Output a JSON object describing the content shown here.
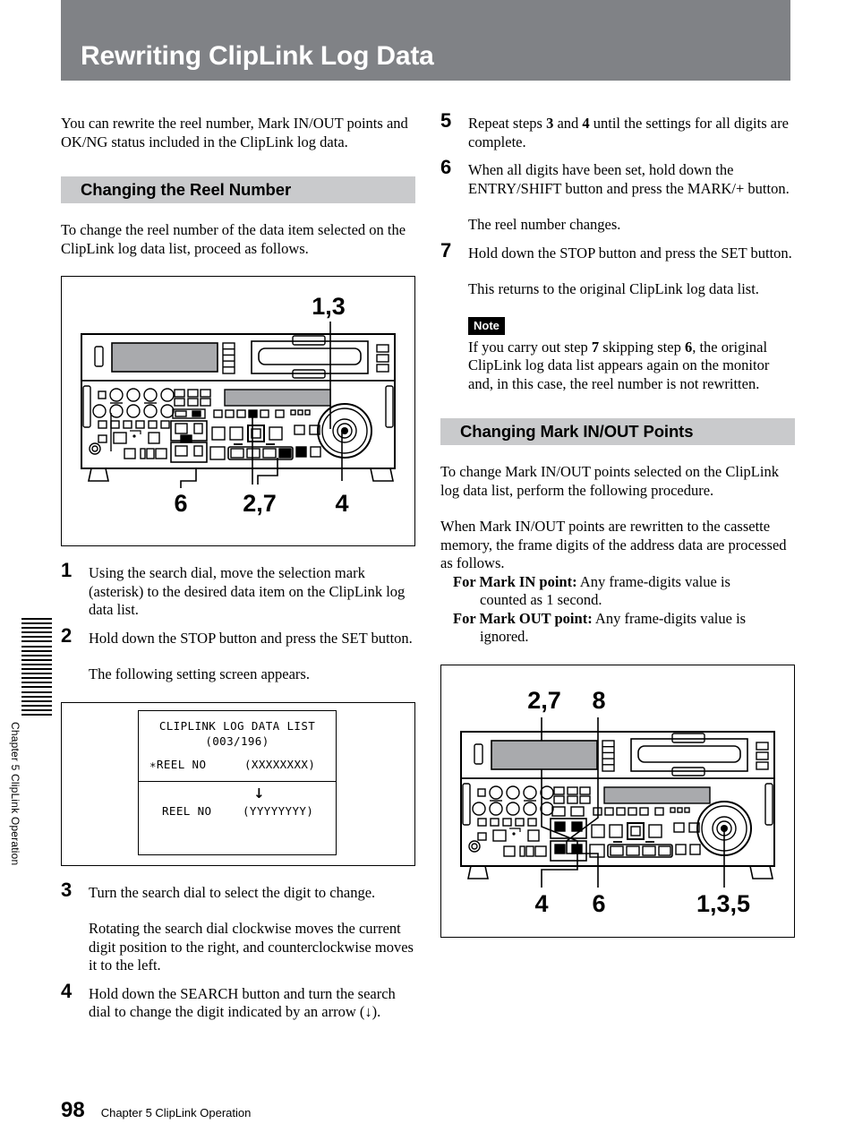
{
  "page": {
    "title": "Rewriting ClipLink Log Data",
    "number": "98",
    "footer_chapter": "Chapter 5   ClipLink Operation",
    "side_tab_label": "Chapter 5   ClipLink Operation"
  },
  "colors": {
    "banner_gray": "#808286",
    "section_head_gray": "#c9cacc",
    "note_tag_bg": "#000000",
    "panel_display_gray": "#a9aaad"
  },
  "intro": {
    "paragraph": "You can rewrite the reel number, Mark IN/OUT points and OK/NG status included in the ClipLink log data."
  },
  "section_reel": {
    "heading": "Changing the Reel Number",
    "intro": "To change the reel number of the data item selected on the ClipLink log data list, proceed as follows.",
    "figure": {
      "name": "vtr-front-panel-reel",
      "callouts_top": [
        "1,3"
      ],
      "callouts_bottom": [
        "6",
        "2,7",
        "4"
      ]
    },
    "steps": [
      {
        "num": "1",
        "text": "Using the search dial, move the selection mark (asterisk) to the desired data item on the ClipLink log data list."
      },
      {
        "num": "2",
        "text": "Hold down the STOP button and press the SET button.",
        "result": "The following setting screen appears."
      },
      {
        "num": "3",
        "text": "Turn the search dial to select the digit to change.",
        "result": "Rotating the search dial clockwise moves the current digit position to the right, and counterclockwise moves it to the left."
      },
      {
        "num": "4",
        "text_pre": "Hold down the SEARCH button and turn the search dial to change the digit indicated by an arrow (",
        "arrow_glyph": "↓",
        "text_post": ")."
      }
    ]
  },
  "osd_screen": {
    "title": "CLIPLINK LOG DATA LIST",
    "counter": "(003/196)",
    "row1_label": "∗REEL NO",
    "row1_value": "(XXXXXXXX)",
    "row2_label": "REEL NO",
    "row2_value": "(YYYYYYYY)",
    "arrow_glyph": "↓"
  },
  "right_steps": [
    {
      "num": "5",
      "parts": [
        "Repeat steps ",
        "3",
        " and ",
        "4",
        " until the settings for all digits are complete."
      ]
    },
    {
      "num": "6",
      "text": "When all digits have been set, hold down the ENTRY/SHIFT button and press the MARK/+ button.",
      "result": "The reel number changes."
    },
    {
      "num": "7",
      "text": "Hold down the STOP button and press the SET button.",
      "result": "This returns to the original ClipLink log data list."
    }
  ],
  "note": {
    "tag": "Note",
    "parts": [
      "If you carry out step ",
      "7",
      " skipping step ",
      "6",
      ", the original ClipLink log data list appears again on the monitor and, in this case, the reel number is not rewritten."
    ]
  },
  "section_mark": {
    "heading": "Changing Mark IN/OUT Points",
    "intro1": "To change Mark IN/OUT points selected on the ClipLink log data list, perform the following procedure.",
    "intro2": "When Mark IN/OUT points are rewritten to the cassette memory, the frame digits of the address data are processed as follows.",
    "bullet1_label": "For Mark IN point:",
    "bullet1_text": " Any frame-digits value is",
    "bullet1_cont": "counted as 1 second.",
    "bullet2_label": "For Mark OUT point:",
    "bullet2_text": " Any frame-digits value is",
    "bullet2_cont": "ignored.",
    "figure": {
      "name": "vtr-front-panel-mark",
      "callouts_top": [
        "2,7",
        "8"
      ],
      "callouts_bottom": [
        "4",
        "6",
        "1,3,5"
      ]
    }
  }
}
